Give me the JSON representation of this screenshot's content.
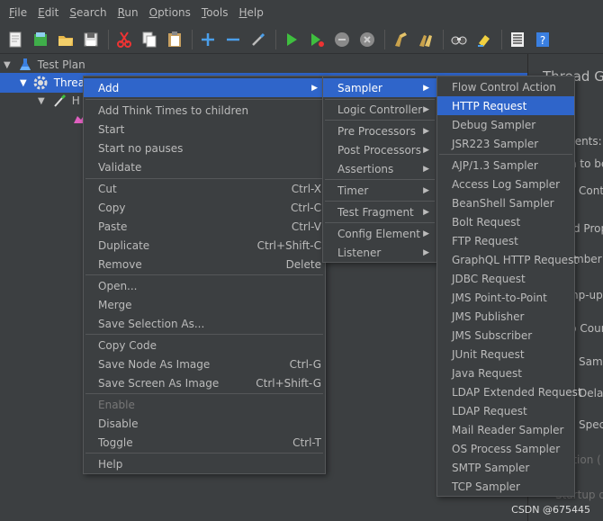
{
  "menubar": {
    "items": [
      {
        "label": "File"
      },
      {
        "label": "Edit"
      },
      {
        "label": "Search"
      },
      {
        "label": "Run"
      },
      {
        "label": "Options"
      },
      {
        "label": "Tools"
      },
      {
        "label": "Help"
      }
    ]
  },
  "toolbar": {
    "icons": [
      "new-icon",
      "templates-icon",
      "open-icon",
      "save-icon",
      "cut-icon",
      "copy-icon",
      "paste-icon",
      "expand-icon",
      "collapse-icon",
      "toggle-icon",
      "start-icon",
      "start-no-pauses-icon",
      "stop-icon",
      "shutdown-icon",
      "clear-icon",
      "clear-all-icon",
      "search-icon",
      "reset-search-icon",
      "function-helper-icon",
      "help-icon"
    ]
  },
  "tree": {
    "test_plan": "Test Plan",
    "thread_group": "Threa",
    "child": "H"
  },
  "right_panel": {
    "title": "Thread Gr",
    "labels": [
      "ments:",
      "n to be",
      "Conti",
      "d Prop",
      "mber o",
      "np-up",
      "p Cour",
      "Same",
      "Delay",
      "Speci",
      "ation (",
      "Startup de"
    ]
  },
  "context_menu": {
    "items": [
      {
        "label": "Add",
        "submenu": true
      },
      {
        "label": "Add Think Times to children"
      },
      {
        "label": "Start"
      },
      {
        "label": "Start no pauses"
      },
      {
        "label": "Validate"
      },
      {
        "label": "Cut",
        "shortcut": "Ctrl-X"
      },
      {
        "label": "Copy",
        "shortcut": "Ctrl-C"
      },
      {
        "label": "Paste",
        "shortcut": "Ctrl-V"
      },
      {
        "label": "Duplicate",
        "shortcut": "Ctrl+Shift-C"
      },
      {
        "label": "Remove",
        "shortcut": "Delete"
      },
      {
        "label": "Open..."
      },
      {
        "label": "Merge"
      },
      {
        "label": "Save Selection As..."
      },
      {
        "label": "Copy Code"
      },
      {
        "label": "Save Node As Image",
        "shortcut": "Ctrl-G"
      },
      {
        "label": "Save Screen As Image",
        "shortcut": "Ctrl+Shift-G"
      },
      {
        "label": "Enable",
        "disabled": true
      },
      {
        "label": "Disable"
      },
      {
        "label": "Toggle",
        "shortcut": "Ctrl-T"
      },
      {
        "label": "Help"
      }
    ]
  },
  "add_menu": {
    "items": [
      {
        "label": "Sampler"
      },
      {
        "label": "Logic Controller"
      },
      {
        "label": "Pre Processors"
      },
      {
        "label": "Post Processors"
      },
      {
        "label": "Assertions"
      },
      {
        "label": "Timer"
      },
      {
        "label": "Test Fragment"
      },
      {
        "label": "Config Element"
      },
      {
        "label": "Listener"
      }
    ]
  },
  "sampler_menu": {
    "items": [
      {
        "label": "Flow Control Action"
      },
      {
        "label": "HTTP Request"
      },
      {
        "label": "Debug Sampler"
      },
      {
        "label": "JSR223 Sampler"
      },
      {
        "label": "AJP/1.3 Sampler"
      },
      {
        "label": "Access Log Sampler"
      },
      {
        "label": "BeanShell Sampler"
      },
      {
        "label": "Bolt Request"
      },
      {
        "label": "FTP Request"
      },
      {
        "label": "GraphQL HTTP Request"
      },
      {
        "label": "JDBC Request"
      },
      {
        "label": "JMS Point-to-Point"
      },
      {
        "label": "JMS Publisher"
      },
      {
        "label": "JMS Subscriber"
      },
      {
        "label": "JUnit Request"
      },
      {
        "label": "Java Request"
      },
      {
        "label": "LDAP Extended Request"
      },
      {
        "label": "LDAP Request"
      },
      {
        "label": "Mail Reader Sampler"
      },
      {
        "label": "OS Process Sampler"
      },
      {
        "label": "SMTP Sampler"
      },
      {
        "label": "TCP Sampler"
      }
    ]
  },
  "watermark": "CSDN @675445"
}
